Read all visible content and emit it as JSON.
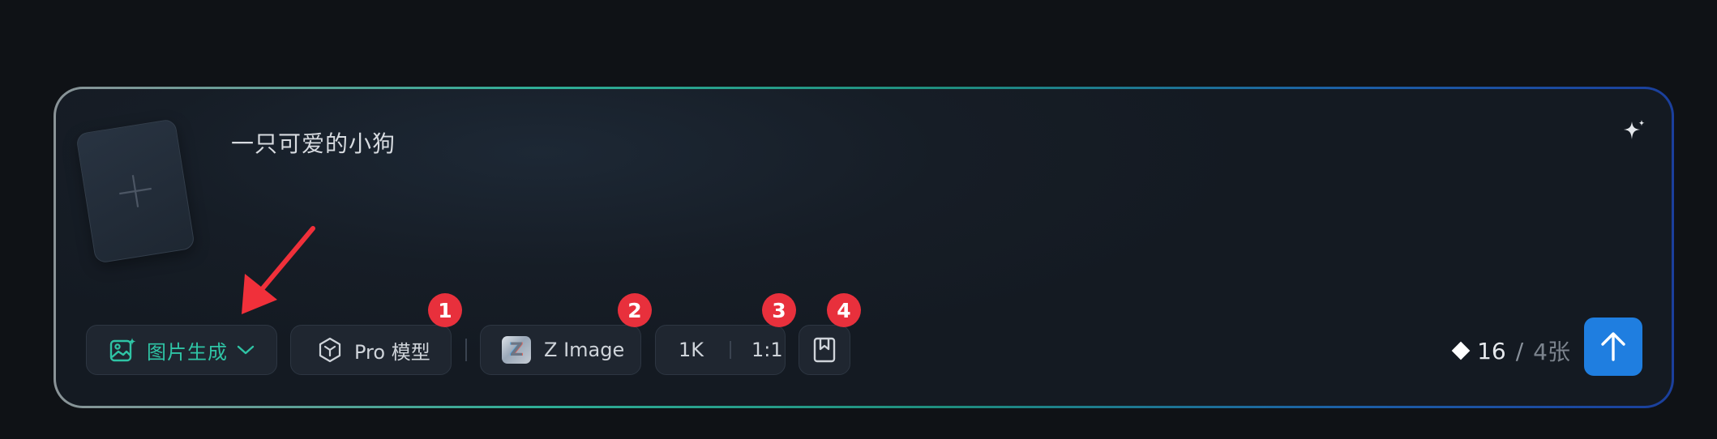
{
  "prompt": {
    "text": "一只可爱的小狗"
  },
  "toolbar": {
    "mode_label": "图片生成",
    "model_label": "Pro 模型",
    "engine_label": "Z Image",
    "engine_logo_text": "Z",
    "resolution": "1K",
    "aspect_ratio": "1:1"
  },
  "badges": {
    "b1": "1",
    "b2": "2",
    "b3": "3",
    "b4": "4"
  },
  "cost": {
    "points": "16",
    "separator": "/",
    "count": "4张"
  },
  "icons": {
    "upload": "plus-icon",
    "sparkle": "sparkle-icon",
    "mode": "image-generate-icon",
    "chevron": "chevron-down-icon",
    "model": "cube-icon",
    "bookmark": "bookmark-icon",
    "diamond": "diamond-icon",
    "send": "arrow-up-icon"
  },
  "colors": {
    "accent_teal": "#2fc4a5",
    "send_blue": "#1f7ee0",
    "badge_red": "#e8303c",
    "annotation_red": "#f0303a",
    "background": "#0f1216"
  }
}
